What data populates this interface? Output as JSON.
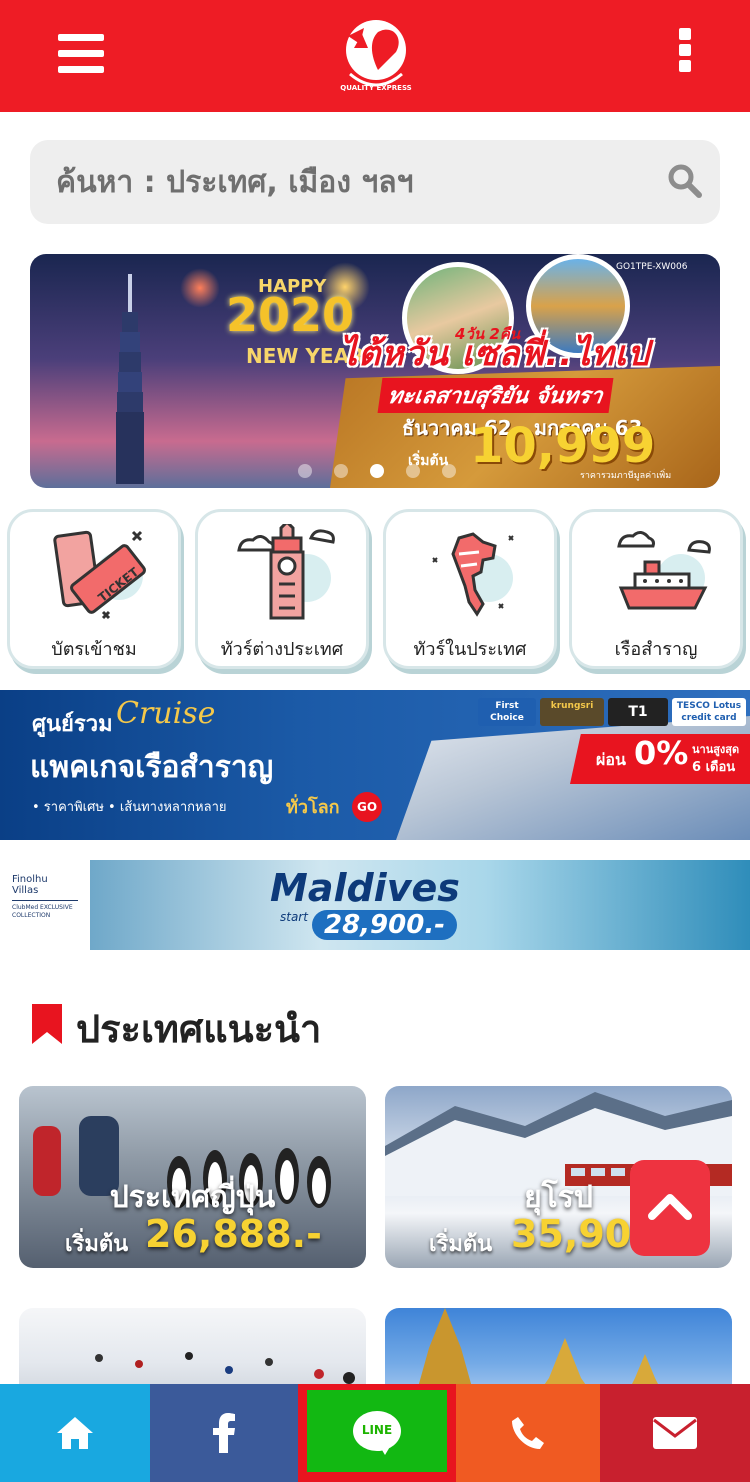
{
  "header": {
    "logo_name": "QUALITY EXPRESS",
    "menu_icon": "hamburger-menu-icon",
    "more_icon": "kebab-menu-icon",
    "brand_color": "#ee1c25"
  },
  "search": {
    "placeholder": "ค้นหา : ประเทศ, เมือง ฯลฯ",
    "icon": "search-icon"
  },
  "hero_banner": {
    "code": "GO1TPE-XW006",
    "happy": "HAPPY",
    "year": "2020",
    "new_year": "NEW YEAR",
    "days": "4วัน 2คืน",
    "title": "ไต้หวัน เซลฟี่..ไทเป",
    "subtitle": "ทะเลสาบสุริยัน จันทรา",
    "dates": "ธันวาคม 62 - มกราคม 63",
    "price_prefix": "เริ่มต้น",
    "price": "10,999",
    "note": "ราคารวมภาษีมูลค่าเพิ่ม",
    "slides_total": 5,
    "active_slide": 3
  },
  "categories": [
    {
      "label": "บัตรเข้าชม",
      "icon": "ticket-icon"
    },
    {
      "label": "ทัวร์ต่างประเทศ",
      "icon": "big-ben-icon"
    },
    {
      "label": "ทัวร์ในประเทศ",
      "icon": "thailand-map-icon"
    },
    {
      "label": "เรือสำราญ",
      "icon": "cruise-ship-icon"
    }
  ],
  "cruise_banner": {
    "line1": "ศูนย์รวม",
    "line1_script": "Cruise",
    "headline": "แพคเกจเรือสำราญ",
    "bullets": "• ราคาพิเศษ   • เส้นทางหลากหลาย",
    "worldwide": "ทั่วโลก",
    "go": "GO",
    "cards": [
      "First Choice",
      "krungsri",
      "T1",
      "TESCO Lotus credit card"
    ],
    "installment_prefix": "ผ่อน",
    "installment_rate": "0%",
    "installment_max": "นานสูงสุด",
    "installment_months": "6 เดือน"
  },
  "maldives_banner": {
    "brand": "Finolhu Villas",
    "brand_sub": "ClubMed EXCLUSIVE COLLECTION",
    "title": "Maldives",
    "start": "start",
    "price": "28,900.-"
  },
  "section": {
    "title": "ประเทศแนะนำ",
    "icon": "bookmark-icon"
  },
  "destinations": [
    {
      "name": "ประเทศญี่ปุ่น",
      "from": "เริ่มต้น",
      "price": "26,888.-"
    },
    {
      "name": "ยุโรป",
      "from": "เริ่มต้น",
      "price": "35,900"
    }
  ],
  "scroll_top_icon": "chevron-up-icon",
  "bottom_bar": [
    {
      "icon": "home-icon",
      "color": "#19a8e0"
    },
    {
      "icon": "facebook-icon",
      "color": "#3b5a9a"
    },
    {
      "icon": "line-icon",
      "label": "LINE",
      "color": "#12b812"
    },
    {
      "icon": "phone-icon",
      "color": "#f05a22"
    },
    {
      "icon": "mail-icon",
      "color": "#c8202e"
    }
  ]
}
